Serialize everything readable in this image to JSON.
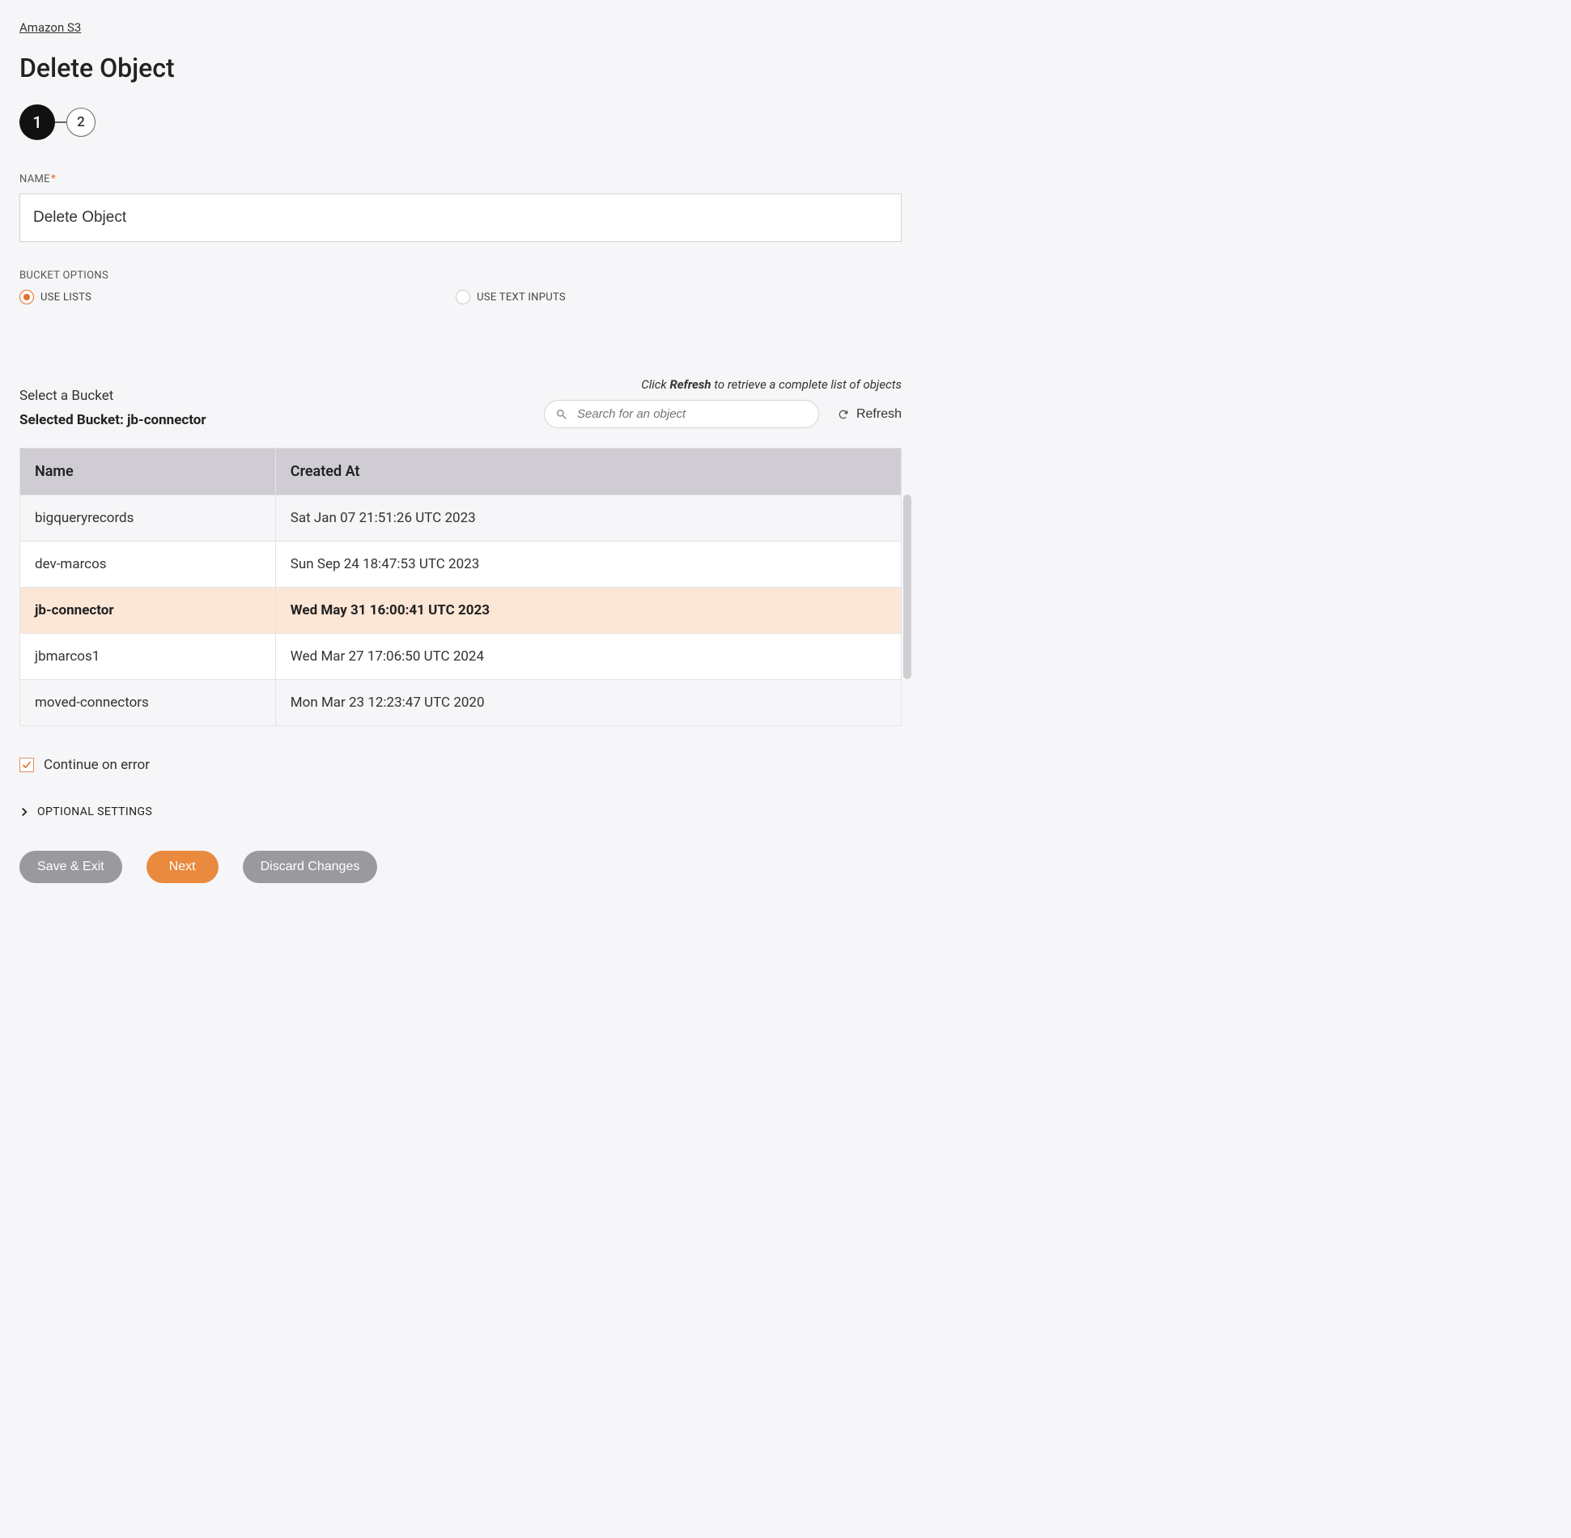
{
  "breadcrumb": "Amazon S3",
  "page_title": "Delete Object",
  "stepper": {
    "step1": "1",
    "step2": "2"
  },
  "name_field": {
    "label": "NAME",
    "value": "Delete Object"
  },
  "bucket_options": {
    "label": "BUCKET OPTIONS",
    "use_lists": "USE LISTS",
    "use_text_inputs": "USE TEXT INPUTS"
  },
  "bucket_section": {
    "select_label": "Select a Bucket",
    "selected_label": "Selected Bucket: jb-connector",
    "refresh_hint_prefix": "Click ",
    "refresh_hint_bold": "Refresh",
    "refresh_hint_suffix": " to retrieve a complete list of objects",
    "search_placeholder": "Search for an object",
    "refresh_button": "Refresh"
  },
  "table": {
    "headers": {
      "name": "Name",
      "created_at": "Created At"
    },
    "rows": [
      {
        "name": "bigqueryrecords",
        "created_at": "Sat Jan 07 21:51:26 UTC 2023",
        "alt": true,
        "selected": false
      },
      {
        "name": "dev-marcos",
        "created_at": "Sun Sep 24 18:47:53 UTC 2023",
        "alt": false,
        "selected": false
      },
      {
        "name": "jb-connector",
        "created_at": "Wed May 31 16:00:41 UTC 2023",
        "alt": false,
        "selected": true
      },
      {
        "name": "jbmarcos1",
        "created_at": "Wed Mar 27 17:06:50 UTC 2024",
        "alt": false,
        "selected": false
      },
      {
        "name": "moved-connectors",
        "created_at": "Mon Mar 23 12:23:47 UTC 2020",
        "alt": true,
        "selected": false
      }
    ]
  },
  "continue_on_error": {
    "label": "Continue on error",
    "checked": true
  },
  "optional_settings": {
    "label": "OPTIONAL SETTINGS"
  },
  "footer": {
    "save_exit": "Save & Exit",
    "next": "Next",
    "discard": "Discard Changes"
  }
}
